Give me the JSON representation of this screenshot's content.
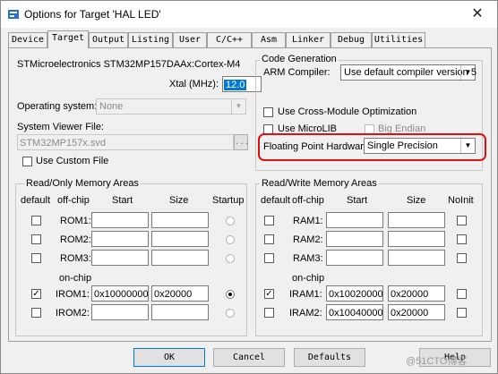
{
  "window": {
    "title": "Options for Target 'HAL LED'",
    "close_glyph": "✕"
  },
  "tabs": [
    "Device",
    "Target",
    "Output",
    "Listing",
    "User",
    "C/C++",
    "Asm",
    "Linker",
    "Debug",
    "Utilities"
  ],
  "target": {
    "device_name": "STMicroelectronics STM32MP157DAAx:Cortex-M4",
    "xtal_label": "Xtal (MHz):",
    "xtal_value": "12.0",
    "os_label": "Operating system:",
    "os_value": "None",
    "svf_label": "System Viewer File:",
    "svf_value": "STM32MP157x.svd",
    "svf_browse": "...",
    "use_custom_file": "Use Custom File"
  },
  "code_gen": {
    "title": "Code Generation",
    "compiler_label": "ARM Compiler:",
    "compiler_value": "Use default compiler version 5",
    "cross_module": "Use Cross-Module Optimization",
    "microlib": "Use MicroLIB",
    "big_endian": "Big Endian",
    "fph_label": "Floating Point Hardware:",
    "fph_value": "Single Precision"
  },
  "ro_mem": {
    "title": "Read/Only Memory Areas",
    "headers": {
      "default": "default",
      "offchip": "off-chip",
      "start": "Start",
      "size": "Size",
      "startup": "Startup"
    },
    "onchip": "on-chip",
    "rows": [
      {
        "label": "ROM1:",
        "start": "",
        "size": "",
        "checked": false,
        "startup": false
      },
      {
        "label": "ROM2:",
        "start": "",
        "size": "",
        "checked": false,
        "startup": false
      },
      {
        "label": "ROM3:",
        "start": "",
        "size": "",
        "checked": false,
        "startup": false
      },
      {
        "label": "IROM1:",
        "start": "0x10000000",
        "size": "0x20000",
        "checked": true,
        "startup": true
      },
      {
        "label": "IROM2:",
        "start": "",
        "size": "",
        "checked": false,
        "startup": false
      }
    ]
  },
  "rw_mem": {
    "title": "Read/Write Memory Areas",
    "headers": {
      "default": "default",
      "offchip": "off-chip",
      "start": "Start",
      "size": "Size",
      "noinit": "NoInit"
    },
    "onchip": "on-chip",
    "rows": [
      {
        "label": "RAM1:",
        "start": "",
        "size": "",
        "checked": false
      },
      {
        "label": "RAM2:",
        "start": "",
        "size": "",
        "checked": false
      },
      {
        "label": "RAM3:",
        "start": "",
        "size": "",
        "checked": false
      },
      {
        "label": "IRAM1:",
        "start": "0x10020000",
        "size": "0x20000",
        "checked": true
      },
      {
        "label": "IRAM2:",
        "start": "0x10040000",
        "size": "0x20000",
        "checked": false
      }
    ]
  },
  "buttons": {
    "ok": "OK",
    "cancel": "Cancel",
    "defaults": "Defaults",
    "help": "Help"
  },
  "watermark": "@51CTO博客"
}
